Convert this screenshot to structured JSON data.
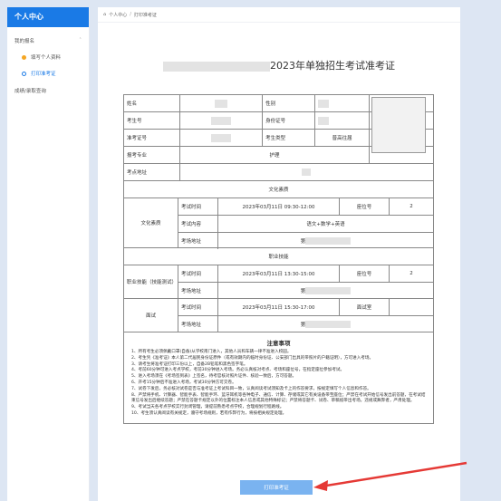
{
  "sidebar": {
    "title": "个人中心",
    "group_label": "我的报名",
    "items": [
      {
        "label": "填写个人资料"
      },
      {
        "label": "打印准考证"
      }
    ],
    "link_label": "成绩/录取查询"
  },
  "breadcrumb": {
    "home": "个人中心",
    "current": "打印准考证"
  },
  "doc_title": "2023年单独招生考试准考证",
  "basic": {
    "name_label": "姓名",
    "gender_label": "性别",
    "exam_no_label": "考生号",
    "id_label": "身份证号",
    "ticket_no_label": "准考证号",
    "type_label": "考生类型",
    "type_value": "普高往届",
    "major_label": "报考专业",
    "major_value": "护理",
    "address_label": "考点地址"
  },
  "section1": {
    "heading": "文化素质",
    "name": "文化素质",
    "time_label": "考试时间",
    "time_value": "2023年03月11日 09:30-12:00",
    "seat_label": "座位号",
    "seat_value": "2",
    "content_label": "考试内容",
    "content_value": "语文+数学+英语",
    "addr_label": "考场地址",
    "addr_value": "第"
  },
  "section2": {
    "heading": "职业技能",
    "name": "职业技能（技能测试）",
    "time_label": "考试时间",
    "time_value": "2023年03月11日 13:30-15:00",
    "seat_label": "座位号",
    "seat_value": "2",
    "addr_label": "考场地址",
    "addr_value": "第"
  },
  "section3": {
    "name": "面试",
    "time_label": "考试时间",
    "time_value": "2023年03月11日 15:30-17:00",
    "room_label": "面试室",
    "addr_label": "考场地址",
    "addr_value": "第"
  },
  "notes": {
    "title": "注意事项",
    "lines": [
      "1、所有考生必须佩戴口罩(自备)从学校南门进入，其他人员和车辆一律不准进入校园。",
      "2、考生凭《准考证》本人第二代居民身份证原件（或有效期内的临时身份证、公安部门出具的带照片的户籍证明），方可进入考场。",
      "3、请考生将准考证打印三份以上，自备2B铅笔和黑色签字笔。",
      "4、考前60分钟可进入考点学校，考前30分钟进入考场。务必认真核对考点、考场和座位号，在指定座位参加考试。",
      "5、进入考场须在《考场签到表》上签名，待考官核对照片证件、核验一致后，方可答题。",
      "6、开考15分钟后不准进入考场，考试30分钟方可交卷。",
      "7、试卷下发后，务必核对试卷是否与准考证上考试科目一致，认真阅读考试须知及卡上的作答要求，按规定填写个人信息和作答。",
      "8、严禁将手机、计算器、智能手表、智能手环、蓝牙耳机等各种电子、通信、计算、存储或其它有关设备带至座位；严禁在考试开始信号发出前答题，在考试结束信号发出后继续答题；严禁在答题卡规定以外的位置标注本人信息或其他特殊标记；严禁将答题卡、试卷、草稿纸带出考场。违规或舞弊者，严肃处理。",
      "9、考试当天各考点学校实行封闭管理，请提前熟悉考点学校，合理规划行程路线。",
      "10、考生须认真阅读有关规定，遵守考场规则，若有作弊行为，将按相关规定处理。"
    ]
  },
  "print_button": "打印准考证",
  "colors": {
    "accent": "#1a7ae6",
    "arrow": "#e53935",
    "button": "#7ab3f0"
  }
}
